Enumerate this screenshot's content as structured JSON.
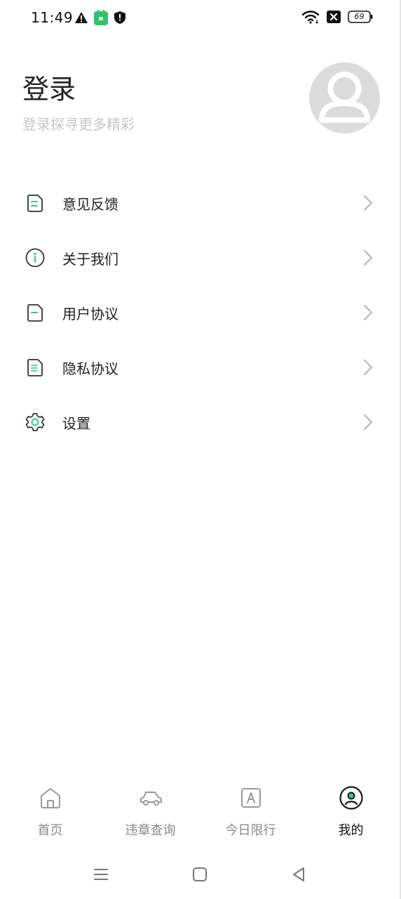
{
  "status_bar": {
    "time": "11:49",
    "battery": "69",
    "left_icons": [
      "warning-icon",
      "app-notification-icon",
      "shield-icon"
    ],
    "right_icons": [
      "wifi-icon",
      "sim-off-icon",
      "battery-icon"
    ]
  },
  "header": {
    "title": "登录",
    "subtitle": "登录探寻更多精彩"
  },
  "menu": {
    "items": [
      {
        "label": "意见反馈",
        "icon": "feedback-doc-icon"
      },
      {
        "label": "关于我们",
        "icon": "info-icon"
      },
      {
        "label": "用户协议",
        "icon": "doc-icon"
      },
      {
        "label": "隐私协议",
        "icon": "doc-icon"
      },
      {
        "label": "设置",
        "icon": "gear-icon"
      }
    ]
  },
  "bottom_nav": {
    "items": [
      {
        "label": "首页",
        "icon": "home-icon",
        "active": false
      },
      {
        "label": "违章查询",
        "icon": "car-icon",
        "active": false
      },
      {
        "label": "今日限行",
        "icon": "letter-a-icon",
        "active": false
      },
      {
        "label": "我的",
        "icon": "profile-icon",
        "active": true
      }
    ]
  },
  "colors": {
    "accent": "#2fc7a0",
    "text_primary": "#222222",
    "text_hint": "#c6c6c6",
    "nav_inactive": "#8a8a8a",
    "avatar_bg": "#dcdcdc"
  }
}
